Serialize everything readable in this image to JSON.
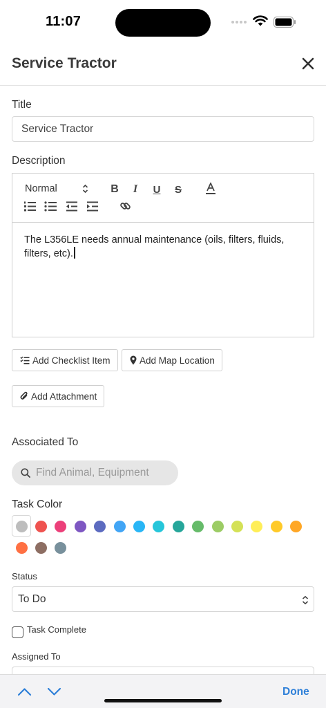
{
  "status_bar": {
    "time": "11:07"
  },
  "header": {
    "title": "Service Tractor"
  },
  "title_field": {
    "label": "Title",
    "value": "Service Tractor"
  },
  "description": {
    "label": "Description",
    "format": "Normal",
    "text": "The L356LE needs annual maintenance (oils, filters, fluids, filters, etc)."
  },
  "actions": {
    "add_checklist": "Add Checklist Item",
    "add_map_location": "Add Map Location",
    "add_attachment": "Add Attachment"
  },
  "associated": {
    "label": "Associated To",
    "placeholder": "Find Animal, Equipment"
  },
  "task_color": {
    "label": "Task Color",
    "colors": [
      "#bdbdbd",
      "#ef5350",
      "#ec407a",
      "#7e57c2",
      "#5c6bc0",
      "#42a5f5",
      "#29b6f6",
      "#26c6da",
      "#26a69a",
      "#66bb6a",
      "#9ccc65",
      "#d4e157",
      "#ffee58",
      "#ffca28",
      "#ffa726",
      "#ff7043",
      "#8d6e63",
      "#78909c"
    ]
  },
  "status": {
    "label": "Status",
    "value": "To Do"
  },
  "task_complete": {
    "label": "Task Complete",
    "checked": false
  },
  "assigned": {
    "label": "Assigned To"
  },
  "bottom_bar": {
    "done": "Done"
  }
}
